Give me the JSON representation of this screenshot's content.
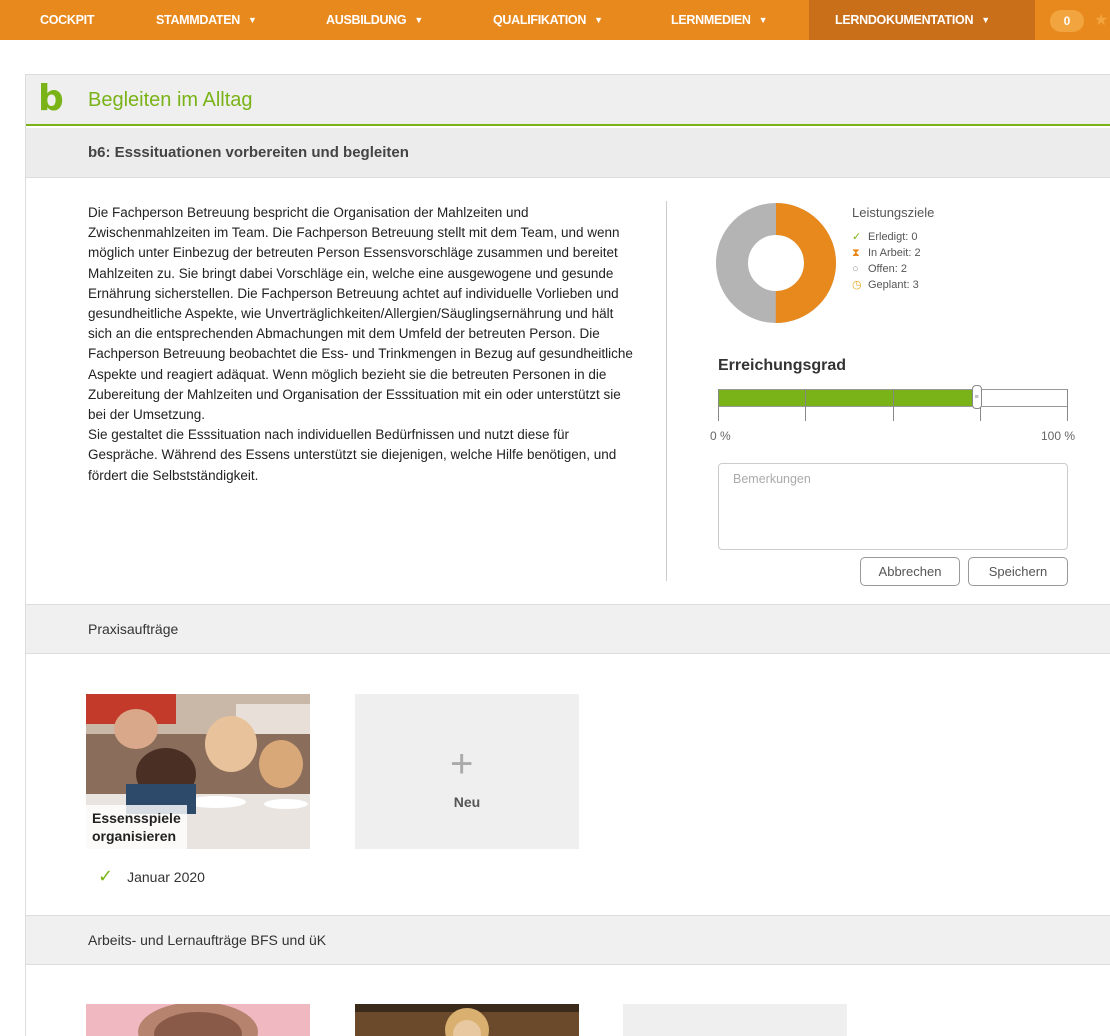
{
  "nav": {
    "items": [
      {
        "label": "COCKPIT",
        "caret": false
      },
      {
        "label": "STAMMDATEN",
        "caret": true
      },
      {
        "label": "AUSBILDUNG",
        "caret": true
      },
      {
        "label": "QUALIFIKATION",
        "caret": true
      },
      {
        "label": "LERNMEDIEN",
        "caret": true
      },
      {
        "label": "LERNDOKUMENTATION",
        "caret": true,
        "active": true
      }
    ],
    "caret_symbol": "▼",
    "badge": "0"
  },
  "header": {
    "letter": "b",
    "title": "Begleiten im Alltag",
    "subtitle": "b6: Esssituationen vorbereiten und begleiten"
  },
  "description": {
    "paragraph1": "Die Fachperson Betreuung bespricht die Organisation der Mahlzeiten und Zwischenmahlzeiten im Team. Die Fachperson Betreuung stellt mit dem Team, und wenn möglich unter Einbezug der betreuten Person Essensvorschläge zusammen und bereitet Mahlzeiten zu. Sie bringt dabei Vorschläge ein, welche eine ausgewogene und gesunde Ernährung sicherstellen. Die Fachperson Betreuung achtet auf individuelle Vorlieben und gesundheitliche Aspekte, wie Unverträglichkeiten/Allergien/Säuglingsernährung und hält sich an die entsprechenden Abmachungen mit dem Umfeld der betreuten Person. Die Fachperson Betreuung beobachtet die Ess- und Trinkmengen in Bezug auf gesundheitliche Aspekte und reagiert adäquat. Wenn möglich bezieht sie die betreuten Personen in die Zubereitung der Mahlzeiten und Organisation der Esssituation mit ein oder unterstützt sie bei der Umsetzung.",
    "paragraph2": "Sie gestaltet die Esssituation nach individuellen Bedürfnissen und nutzt diese für Gespräche. Während des Essens unterstützt sie diejenigen, welche Hilfe benötigen, und fördert die Selbstständigkeit."
  },
  "leistungsziele": {
    "title": "Leistungsziele",
    "items": [
      {
        "label": "Erledigt:",
        "value": "0",
        "icon": "check-icon",
        "color": "#7ab317"
      },
      {
        "label": "In Arbeit:",
        "value": "2",
        "icon": "hourglass-icon",
        "color": "#e8891d"
      },
      {
        "label": "Offen:",
        "value": "2",
        "icon": "circle-icon",
        "color": "#999999"
      },
      {
        "label": "Geplant:",
        "value": "3",
        "icon": "clock-icon",
        "color": "#e8a81d"
      }
    ],
    "donut": {
      "orange_fraction": 0.5,
      "orange": "#e8891d",
      "grey": "#b4b4b4"
    }
  },
  "erreichungsgrad": {
    "title": "Erreichungsgrad",
    "value_percent": 74,
    "min_label": "0 %",
    "max_label": "100 %",
    "fill_color": "#7ab317"
  },
  "remarks": {
    "placeholder": "Bemerkungen",
    "value": ""
  },
  "buttons": {
    "cancel": "Abbrechen",
    "save": "Speichern"
  },
  "praxis": {
    "title": "Praxisaufträge",
    "cards": [
      {
        "label_line1": "Essensspiele",
        "label_line2": "organisieren",
        "date": "Januar 2020",
        "status_icon": "check-icon"
      }
    ],
    "new_label": "Neu",
    "plus_symbol": "+"
  },
  "arbeits": {
    "title": "Arbeits- und Lernaufträge BFS und üK"
  }
}
